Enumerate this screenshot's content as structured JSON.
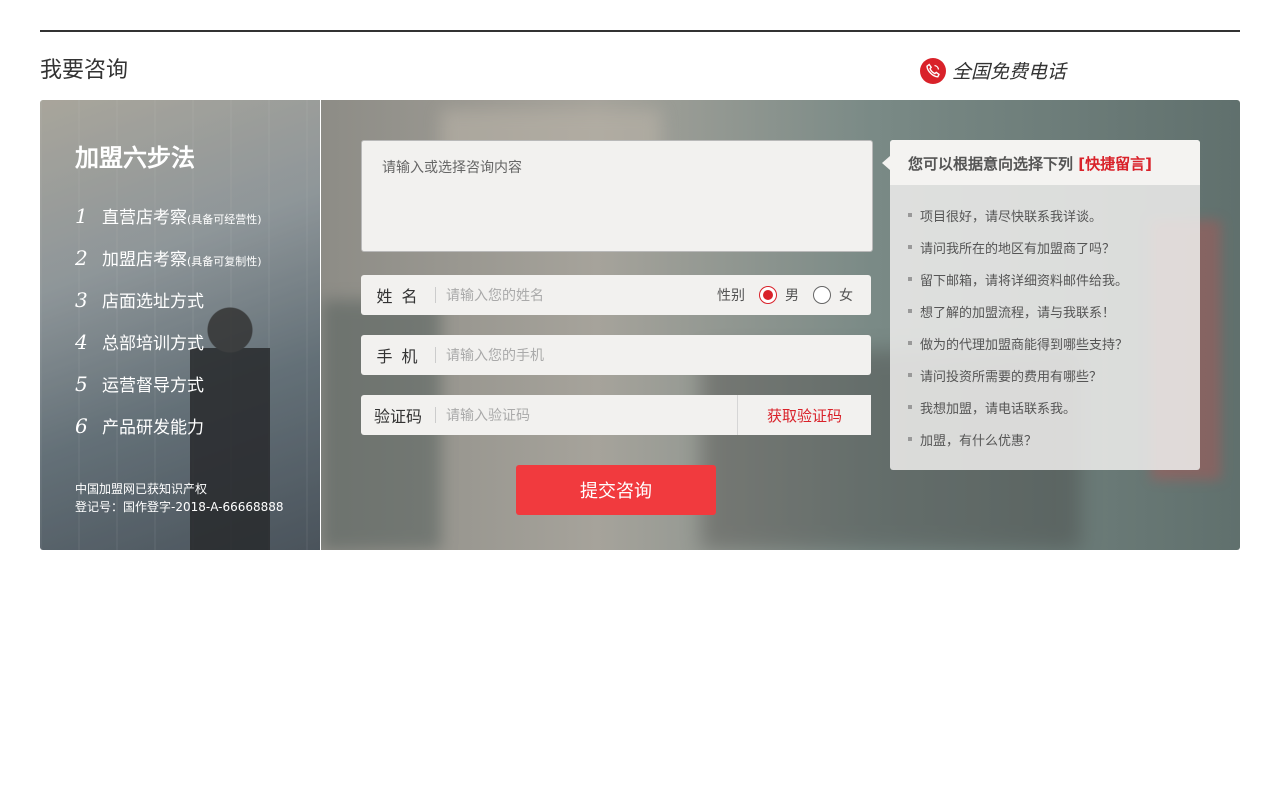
{
  "header": {
    "title": "我要咨询",
    "hotline_label": "全国免费电话"
  },
  "steps": {
    "title": "加盟六步法",
    "items": [
      {
        "num": "1",
        "label": "直营店考察",
        "note": "(具备可经营性)"
      },
      {
        "num": "2",
        "label": "加盟店考察",
        "note": "(具备可复制性)"
      },
      {
        "num": "3",
        "label": "店面选址方式",
        "note": ""
      },
      {
        "num": "4",
        "label": "总部培训方式",
        "note": ""
      },
      {
        "num": "5",
        "label": "运营督导方式",
        "note": ""
      },
      {
        "num": "6",
        "label": "产品研发能力",
        "note": ""
      }
    ],
    "copyright_line1": "中国加盟网已获知识产权",
    "copyright_line2": "登记号：国作登字-2018-A-66668888"
  },
  "form": {
    "consult_placeholder": "请输入或选择咨询内容",
    "name_label": "姓 名",
    "name_placeholder": "请输入您的姓名",
    "gender_label": "性别",
    "gender_options": [
      "男",
      "女"
    ],
    "gender_selected": "男",
    "phone_label": "手 机",
    "phone_placeholder": "请输入您的手机",
    "code_label": "验证码",
    "code_placeholder": "请输入验证码",
    "get_code_button": "获取验证码",
    "submit_button": "提交咨询"
  },
  "quick": {
    "header_text": "您可以根据意向选择下列",
    "header_link": "[快捷留言]",
    "messages": [
      "项目很好，请尽快联系我详谈。",
      "请问我所在的地区有加盟商了吗？",
      "留下邮箱，请将详细资料邮件给我。",
      "想了解的加盟流程，请与我联系！",
      "做为的代理加盟商能得到哪些支持？",
      "请问投资所需要的费用有哪些？",
      "我想加盟，请电话联系我。",
      "加盟，有什么优惠？"
    ]
  },
  "colors": {
    "accent": "#d9222a",
    "submit": "#f13a3e"
  }
}
